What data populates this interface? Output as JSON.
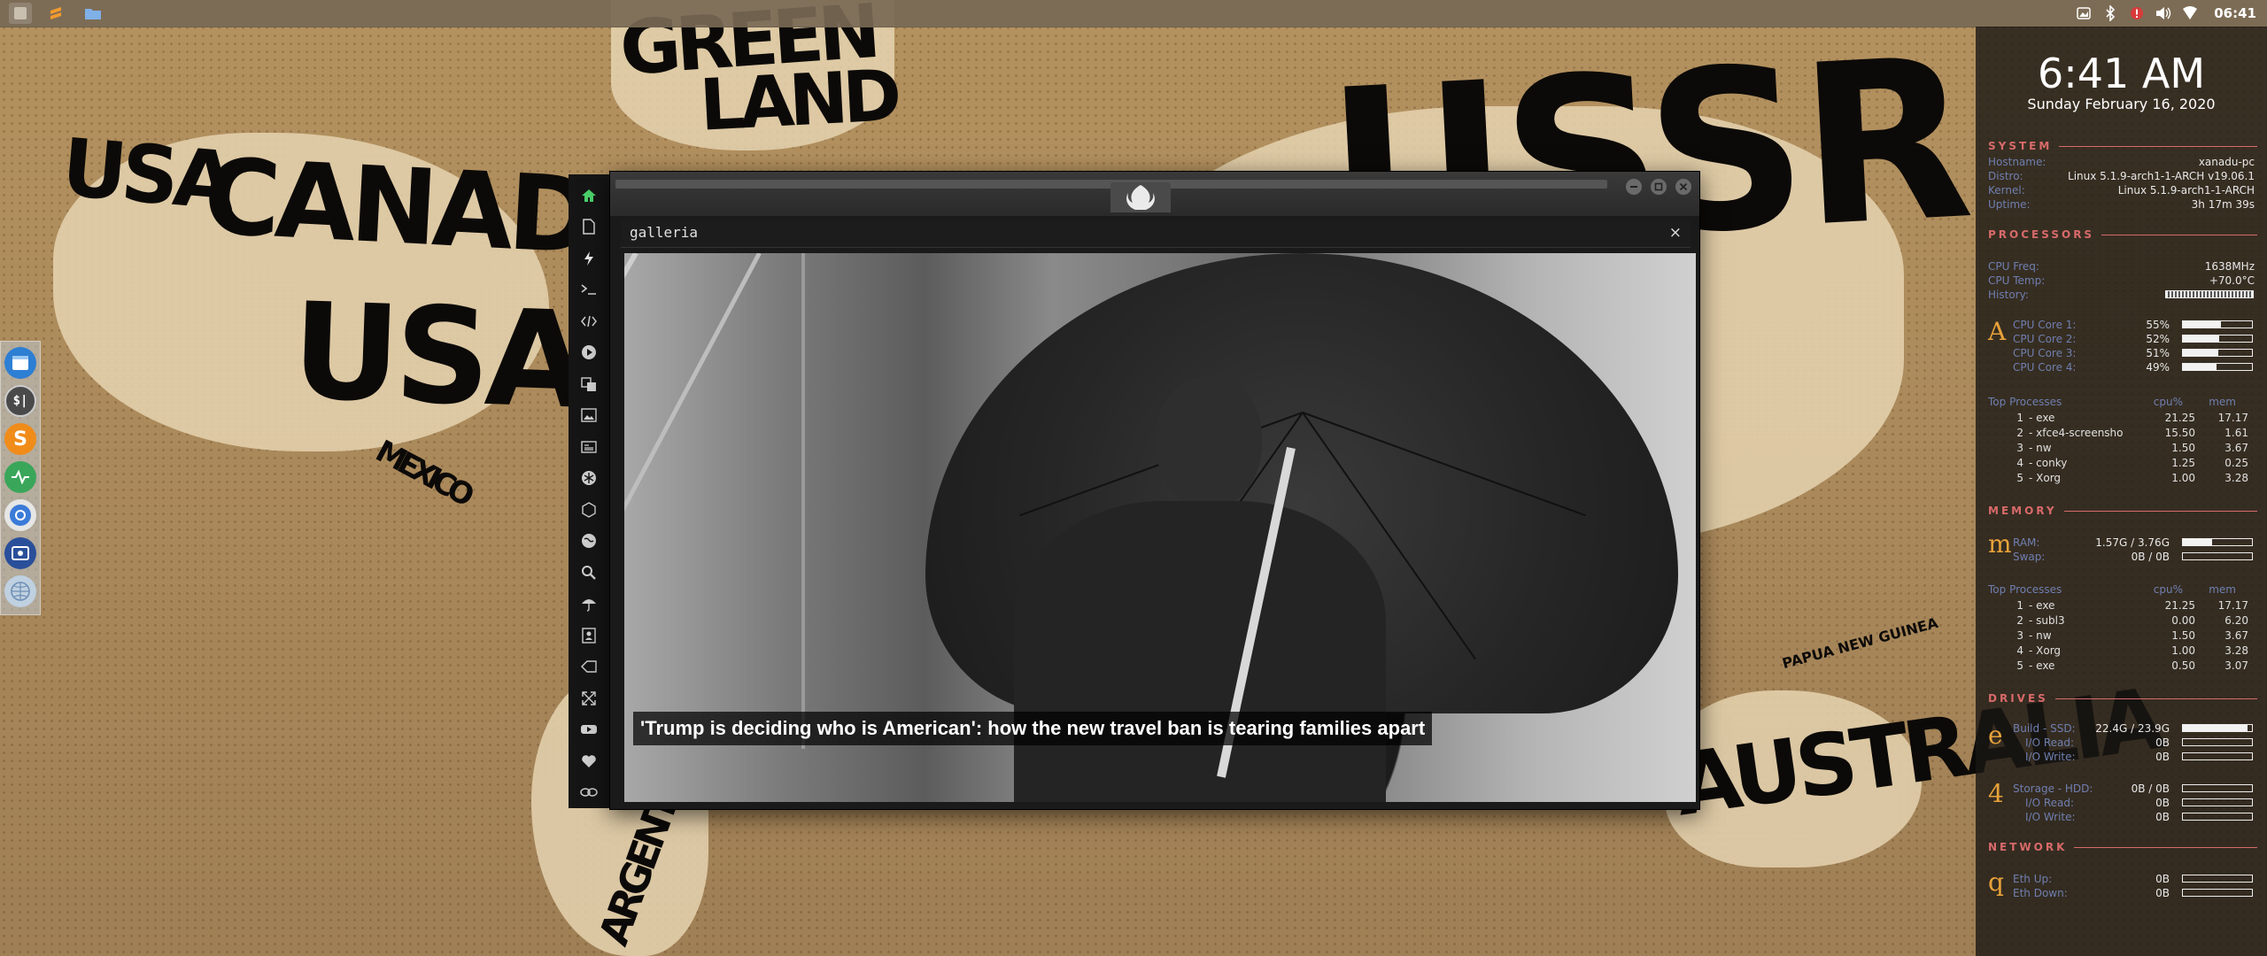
{
  "wallpaper": {
    "words": [
      "GREEN",
      "LAND",
      "USA",
      "CANADA",
      "USA",
      "MEXICO",
      "USSR",
      "AUSTRALIA",
      "ARGENTINA",
      "PAPUA NEW GUINEA"
    ]
  },
  "top_panel": {
    "launchers": [
      {
        "icon": "app-menu-icon"
      },
      {
        "icon": "sublime-text-icon"
      },
      {
        "icon": "folder-icon"
      }
    ],
    "tray_icons": [
      "screenshot-icon",
      "bluetooth-icon",
      "notification-icon",
      "volume-icon",
      "wifi-icon"
    ],
    "clock": "06:41"
  },
  "dock": {
    "items": [
      {
        "icon": "file-manager-icon"
      },
      {
        "icon": "terminal-icon"
      },
      {
        "icon": "sublime-text-icon"
      },
      {
        "icon": "system-monitor-icon"
      },
      {
        "icon": "chrome-browser-icon"
      },
      {
        "icon": "screenshot-tool-icon"
      },
      {
        "icon": "network-globe-icon"
      }
    ]
  },
  "app_sidebar": {
    "icons": [
      "home-icon",
      "document-icon",
      "lightning-icon",
      "terminal-prompt-icon",
      "code-icon",
      "play-icon",
      "translate-icon",
      "image-icon",
      "newspaper-icon",
      "snowflake-icon",
      "hexagon-icon",
      "globe-icon",
      "search-icon",
      "umbrella-icon",
      "contact-card-icon",
      "tag-icon",
      "expand-icon",
      "youtube-icon",
      "heart-icon",
      "link-icon"
    ]
  },
  "window": {
    "app_name": "galleria",
    "close_label": "×",
    "caption": "'Trump is deciding who is American': how the new travel ban is tearing families apart"
  },
  "conky": {
    "time": "6:41 AM",
    "date": "Sunday February 16, 2020",
    "system": {
      "heading": "SYSTEM",
      "rows": [
        {
          "label": "Hostname:",
          "value": "xanadu-pc"
        },
        {
          "label": "Distro:",
          "value": "Linux 5.1.9-arch1-1-ARCH v19.06.1"
        },
        {
          "label": "Kernel:",
          "value": "Linux 5.1.9-arch1-1-ARCH"
        },
        {
          "label": "Uptime:",
          "value": "3h 17m 39s"
        }
      ]
    },
    "processors": {
      "heading": "PROCESSORS",
      "freq_label": "CPU Freq:",
      "freq_value": "1638MHz",
      "temp_label": "CPU Temp:",
      "temp_value": "+70.0°C",
      "history_label": "History:",
      "letter": "A",
      "cores": [
        {
          "label": "CPU Core 1:",
          "value": "55%",
          "level": 0.55
        },
        {
          "label": "CPU Core 2:",
          "value": "52%",
          "level": 0.52
        },
        {
          "label": "CPU Core 3:",
          "value": "51%",
          "level": 0.51
        },
        {
          "label": "CPU Core 4:",
          "value": "49%",
          "level": 0.49
        }
      ],
      "top_label": "Top Processes",
      "cpu_col": "cpu%",
      "mem_col": "mem",
      "top": [
        {
          "rank": "1",
          "name": "- exe",
          "cpu": "21.25",
          "mem": "17.17"
        },
        {
          "rank": "2",
          "name": "- xfce4-screensho",
          "cpu": "15.50",
          "mem": "1.61"
        },
        {
          "rank": "3",
          "name": "- nw",
          "cpu": "1.50",
          "mem": "3.67"
        },
        {
          "rank": "4",
          "name": "- conky",
          "cpu": "1.25",
          "mem": "0.25"
        },
        {
          "rank": "5",
          "name": "- Xorg",
          "cpu": "1.00",
          "mem": "3.28"
        }
      ]
    },
    "memory": {
      "heading": "MEMORY",
      "letter": "m",
      "ram_label": "RAM:",
      "ram_value": "1.57G / 3.76G",
      "ram_level": 0.42,
      "swap_label": "Swap:",
      "swap_value": "0B / 0B",
      "swap_level": 0,
      "top_label": "Top Processes",
      "cpu_col": "cpu%",
      "mem_col": "mem",
      "top": [
        {
          "rank": "1",
          "name": "- exe",
          "cpu": "21.25",
          "mem": "17.17"
        },
        {
          "rank": "2",
          "name": "- subl3",
          "cpu": "0.00",
          "mem": "6.20"
        },
        {
          "rank": "3",
          "name": "- nw",
          "cpu": "1.50",
          "mem": "3.67"
        },
        {
          "rank": "4",
          "name": "- Xorg",
          "cpu": "1.00",
          "mem": "3.28"
        },
        {
          "rank": "5",
          "name": "- exe",
          "cpu": "0.50",
          "mem": "3.07"
        }
      ]
    },
    "drives": {
      "heading": "DRIVES",
      "letter_1": "e",
      "letter_2": "4",
      "build_label": "Build - SSD:",
      "build_value": "22.4G / 23.9G",
      "build_level": 0.94,
      "build_read_label": "I/O Read:",
      "build_read_value": "0B",
      "build_write_label": "I/O Write:",
      "build_write_value": "0B",
      "storage_label": "Storage - HDD:",
      "storage_value": "0B / 0B",
      "storage_level": 0,
      "storage_read_label": "I/O Read:",
      "storage_read_value": "0B",
      "storage_write_label": "I/O Write:",
      "storage_write_value": "0B"
    },
    "network": {
      "heading": "NETWORK",
      "letter": "q",
      "up_label": "Eth Up:",
      "up_value": "0B",
      "down_label": "Eth Down:",
      "down_value": "0B"
    }
  }
}
